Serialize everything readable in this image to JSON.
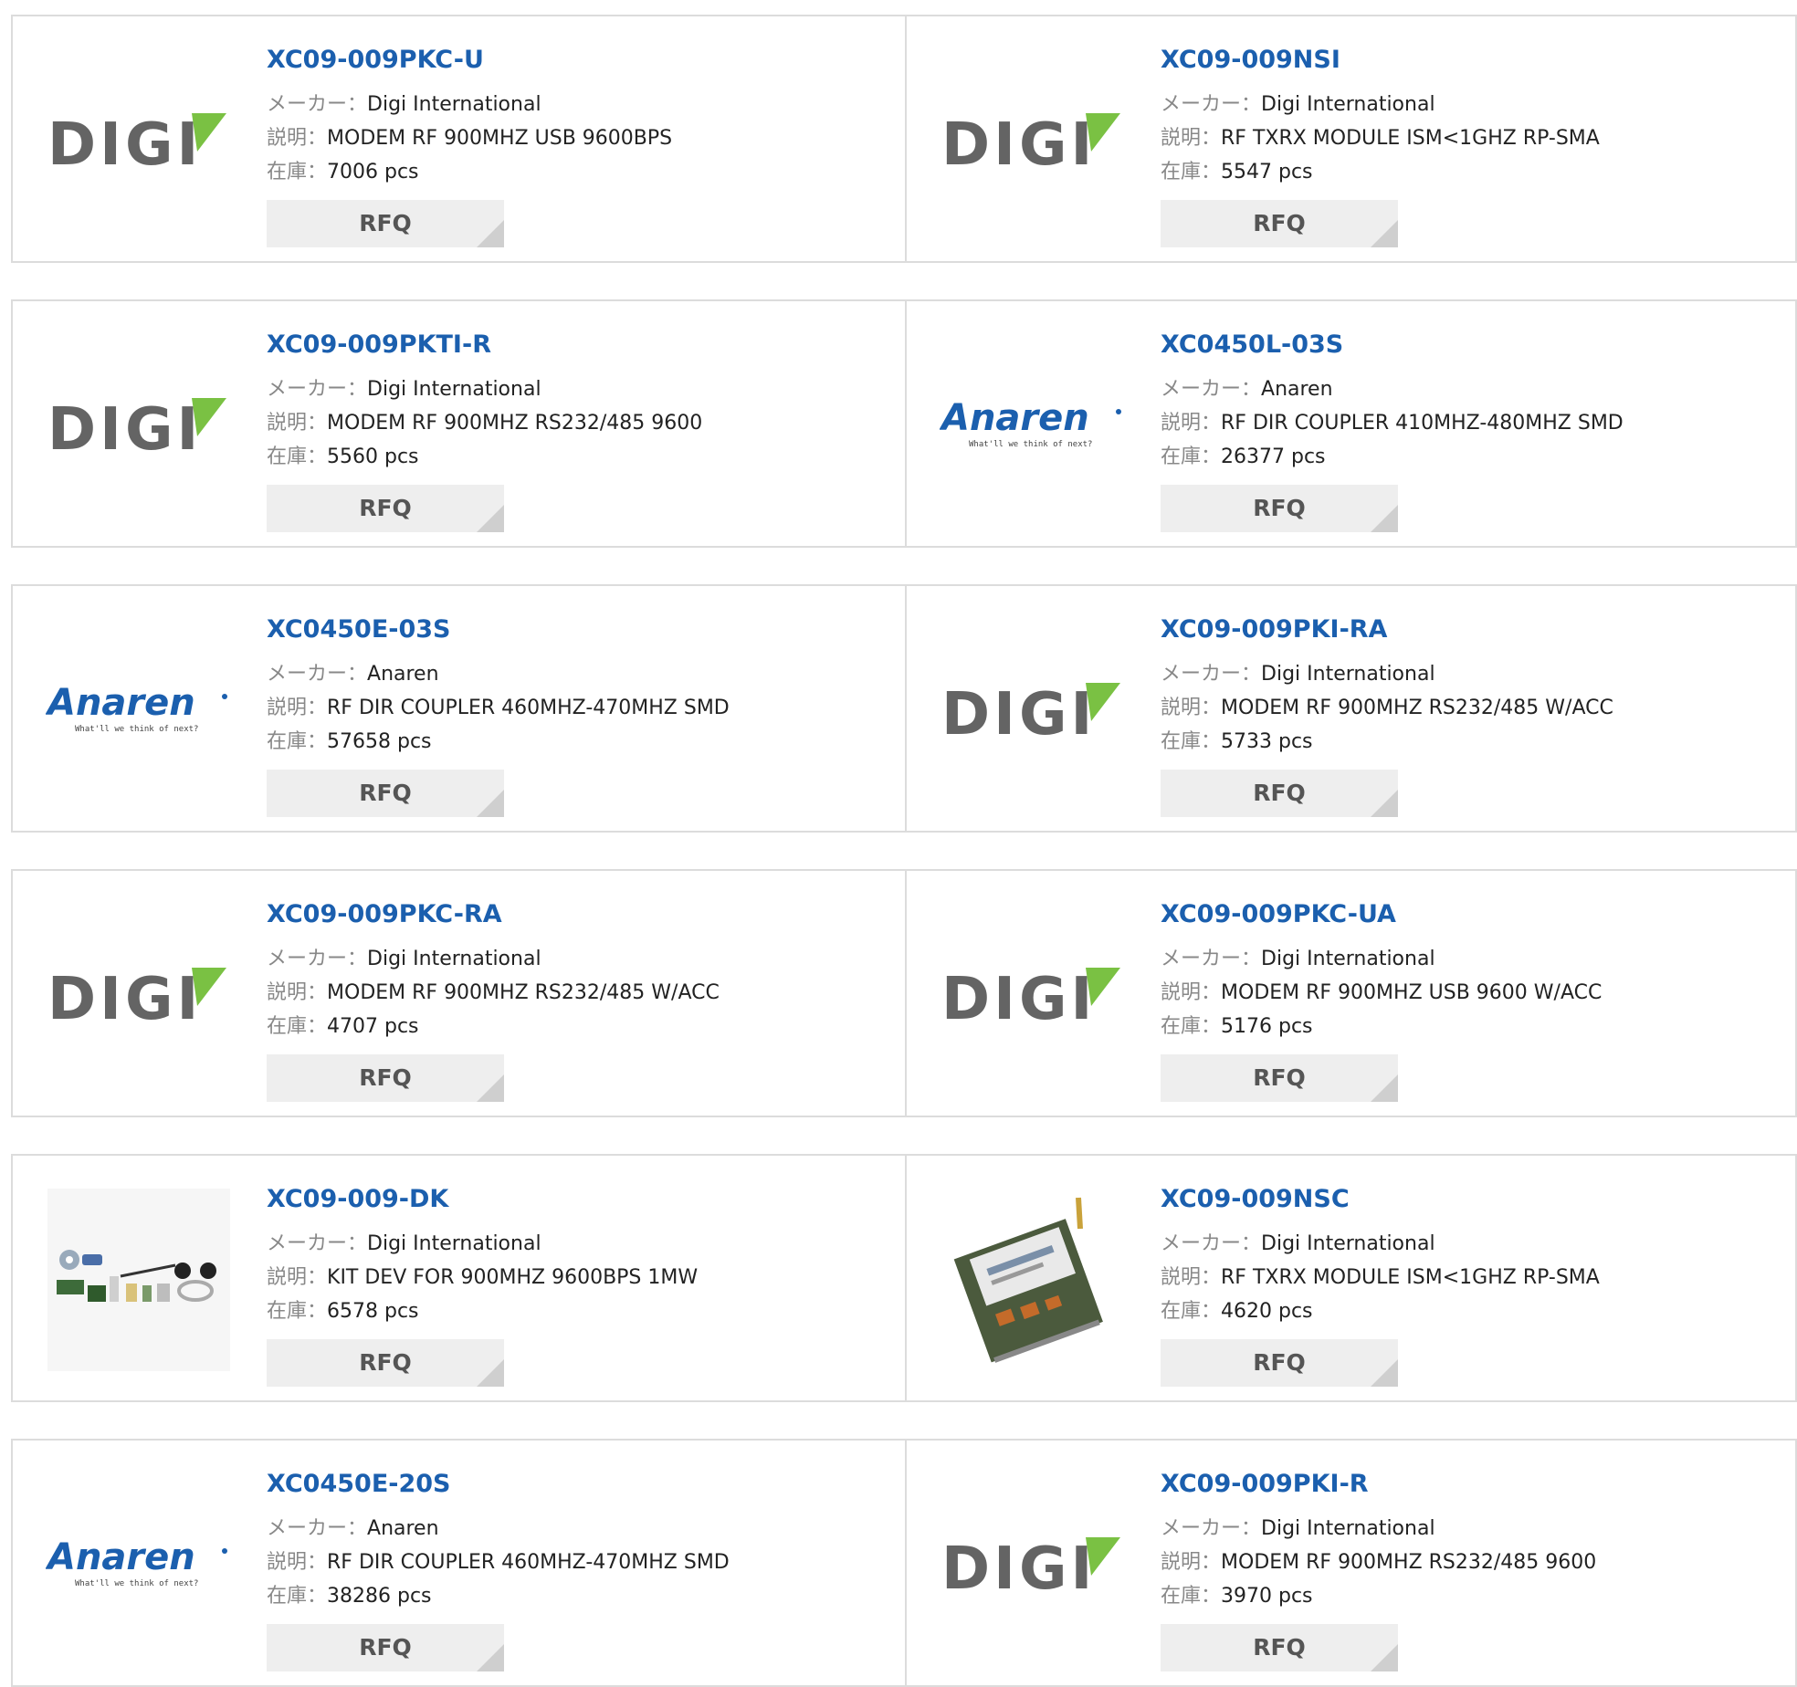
{
  "labels": {
    "maker": "メーカー：",
    "desc": "説明：",
    "stock": "在庫：",
    "rfq": "RFQ"
  },
  "logos": {
    "digi_text": "DIGI",
    "anaren_text": "Anaren",
    "anaren_tagline": "What'll we think of next?"
  },
  "colors": {
    "link": "#1b5fae",
    "digi_gray": "#646464",
    "digi_green": "#7ac143",
    "anaren_blue": "#1b5fae"
  },
  "products": [
    {
      "pn": "XC09-009PKC-U",
      "maker": "Digi International",
      "desc": "MODEM RF 900MHZ USB 9600BPS",
      "stock": "7006 pcs",
      "logo": "digi"
    },
    {
      "pn": "XC09-009NSI",
      "maker": "Digi International",
      "desc": "RF TXRX MODULE ISM<1GHZ RP-SMA",
      "stock": "5547 pcs",
      "logo": "digi"
    },
    {
      "pn": "XC09-009PKTI-R",
      "maker": "Digi International",
      "desc": "MODEM RF 900MHZ RS232/485 9600",
      "stock": "5560 pcs",
      "logo": "digi"
    },
    {
      "pn": "XC0450L-03S",
      "maker": "Anaren",
      "desc": "RF DIR COUPLER 410MHZ-480MHZ SMD",
      "stock": "26377 pcs",
      "logo": "anaren"
    },
    {
      "pn": "XC0450E-03S",
      "maker": "Anaren",
      "desc": "RF DIR COUPLER 460MHZ-470MHZ SMD",
      "stock": "57658 pcs",
      "logo": "anaren"
    },
    {
      "pn": "XC09-009PKI-RA",
      "maker": "Digi International",
      "desc": "MODEM RF 900MHZ RS232/485 W/ACC",
      "stock": "5733 pcs",
      "logo": "digi"
    },
    {
      "pn": "XC09-009PKC-RA",
      "maker": "Digi International",
      "desc": "MODEM RF 900MHZ RS232/485 W/ACC",
      "stock": "4707 pcs",
      "logo": "digi"
    },
    {
      "pn": "XC09-009PKC-UA",
      "maker": "Digi International",
      "desc": "MODEM RF 900MHZ USB 9600 W/ACC",
      "stock": "5176 pcs",
      "logo": "digi"
    },
    {
      "pn": "XC09-009-DK",
      "maker": "Digi International",
      "desc": "KIT DEV FOR 900MHZ 9600BPS 1MW",
      "stock": "6578 pcs",
      "logo": "kit-photo"
    },
    {
      "pn": "XC09-009NSC",
      "maker": "Digi International",
      "desc": "RF TXRX MODULE ISM<1GHZ RP-SMA",
      "stock": "4620 pcs",
      "logo": "module-photo"
    },
    {
      "pn": "XC0450E-20S",
      "maker": "Anaren",
      "desc": "RF DIR COUPLER 460MHZ-470MHZ SMD",
      "stock": "38286 pcs",
      "logo": "anaren"
    },
    {
      "pn": "XC09-009PKI-R",
      "maker": "Digi International",
      "desc": "MODEM RF 900MHZ RS232/485 9600",
      "stock": "3970 pcs",
      "logo": "digi"
    }
  ]
}
